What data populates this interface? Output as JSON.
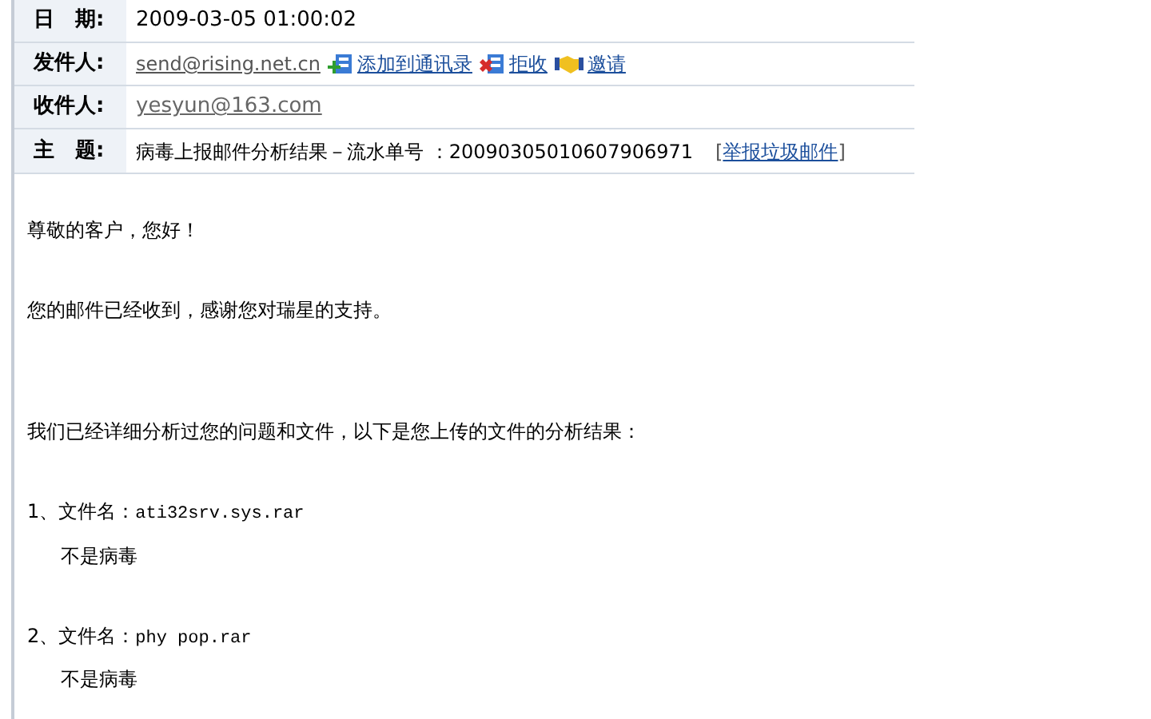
{
  "header": {
    "date": {
      "label": "日　期:",
      "value": "2009-03-05 01:00:02"
    },
    "sender": {
      "label": "发件人:",
      "email": "send@rising.net.cn",
      "actions": [
        {
          "kind": "add",
          "label": "添加到通讯录"
        },
        {
          "kind": "reject",
          "label": "拒收"
        },
        {
          "kind": "invite",
          "label": "邀请"
        }
      ]
    },
    "recipient": {
      "label": "收件人:",
      "email": "yesyun@163.com"
    },
    "subject": {
      "label": "主　题:",
      "text": "病毒上报邮件分析结果－流水单号 ：20090305010607906971",
      "report_link": "举报垃圾邮件",
      "bracket_open": "[",
      "bracket_close": "]"
    }
  },
  "body": {
    "greeting": "尊敬的客户，您好！",
    "thanks": "您的邮件已经收到，感谢您对瑞星的支持。",
    "intro": "我们已经详细分析过您的问题和文件，以下是您上传的文件的分析结果：",
    "files": [
      {
        "prefix": "1、文件名：",
        "filename": "ati32srv.sys.rar",
        "verdict": "不是病毒"
      },
      {
        "prefix": "2、文件名：",
        "filename": "phy pop.rar",
        "verdict": "不是病毒"
      }
    ]
  }
}
